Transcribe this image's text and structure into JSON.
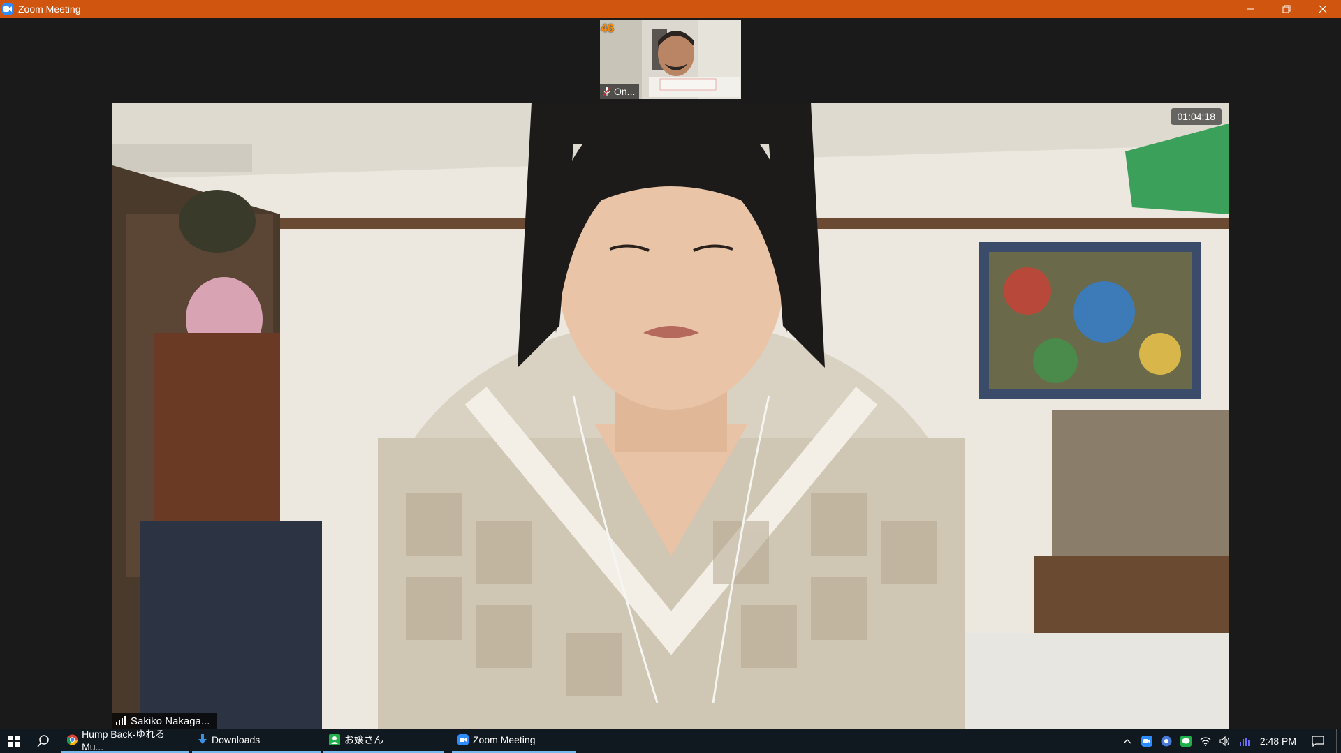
{
  "window": {
    "title": "Zoom Meeting",
    "controls": [
      "minimize",
      "restore",
      "close"
    ]
  },
  "meeting": {
    "thumbnail": {
      "count_badge": "46",
      "name": "On..."
    },
    "main": {
      "timer": "01:04:18",
      "speaker_name": "Sakiko Nakaga..."
    }
  },
  "taskbar": {
    "items": [
      {
        "label": "Hump Back-ゆれる Mu...",
        "icon": "chrome-icon"
      },
      {
        "label": "Downloads",
        "icon": "download-icon"
      },
      {
        "label": "お嬢さん",
        "icon": "contact-icon"
      },
      {
        "label": "Zoom Meeting",
        "icon": "zoom-icon"
      }
    ],
    "clock": "2:48 PM"
  },
  "colors": {
    "titlebar": "#d0560f",
    "zoom_blue": "#2d8cff",
    "taskbar": "#101820",
    "thumb_badge": "#f58a07"
  }
}
